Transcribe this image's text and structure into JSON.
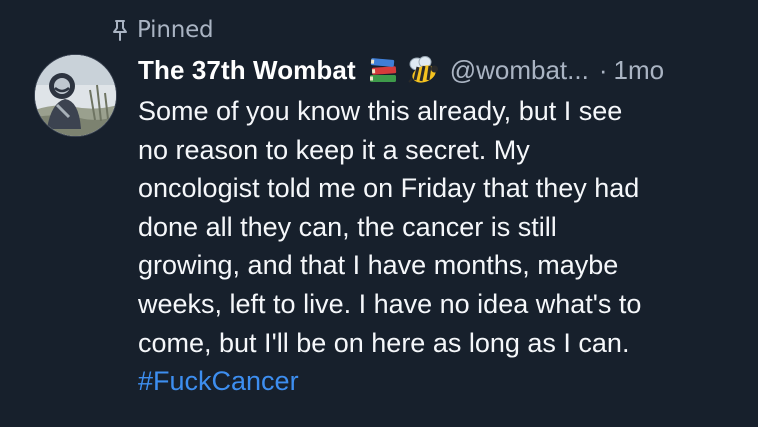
{
  "pinned": {
    "label": "Pinned",
    "icon": "pin-icon"
  },
  "author": {
    "display_name": "The 37th Wombat",
    "emojis": [
      "books-emoji",
      "bee-emoji"
    ],
    "handle": "@wombat...",
    "separator": "·",
    "timestamp": "1mo",
    "avatar": "avatar"
  },
  "post": {
    "lines": [
      "Some of you know this already, but I see",
      "no reason to keep it a secret. My",
      "oncologist told me on Friday that they had",
      "done all they can, the cancer is still",
      "growing, and that I have months, maybe",
      "weeks, left to live. I have no idea what's to",
      "come, but I'll be on here as long as I can."
    ],
    "hashtag": "#FuckCancer"
  },
  "colors": {
    "background": "#17202c",
    "text": "#f5f7fa",
    "muted": "#aab4c3",
    "link": "#3d8ef0"
  }
}
